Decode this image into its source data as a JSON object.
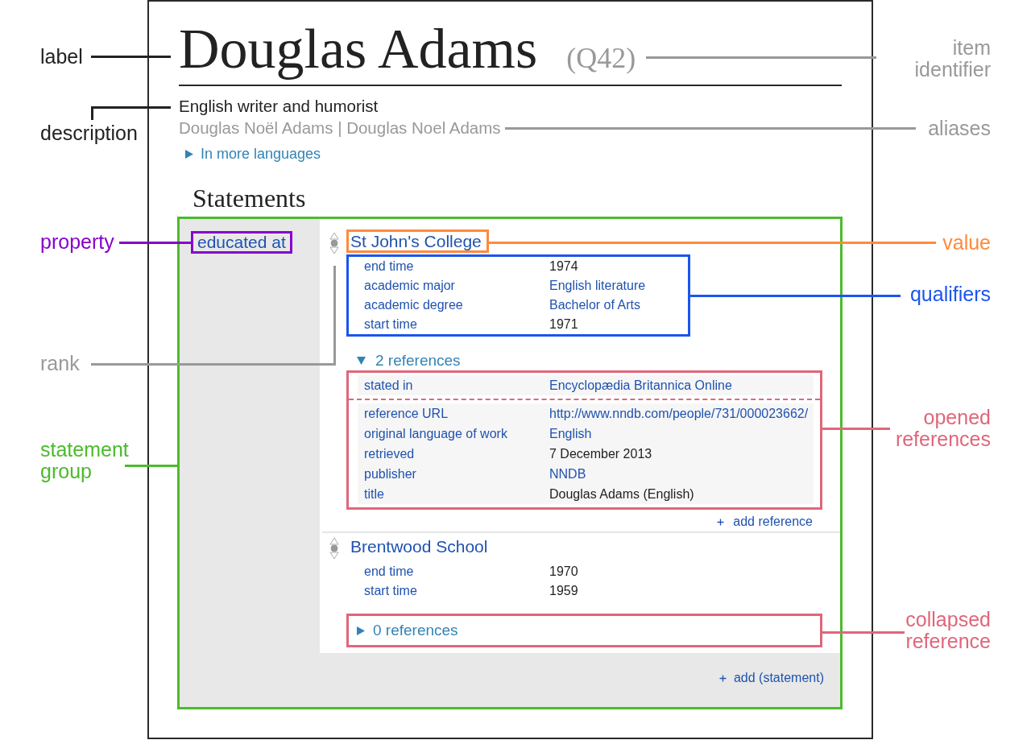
{
  "item": {
    "label": "Douglas Adams",
    "identifier": "(Q42)",
    "description": "English writer and humorist",
    "aliases": "Douglas Noël Adams | Douglas Noel Adams",
    "more_languages": {
      "label": "In more languages",
      "expanded": false
    }
  },
  "statements_heading": "Statements",
  "statement_group": {
    "property": "educated at",
    "statements": [
      {
        "preferred": false,
        "deprecated": false,
        "value": "St John's College",
        "qualifiers": [
          {
            "property": "end time",
            "value": "1974",
            "kind": "text"
          },
          {
            "property": "academic major",
            "value": "English literature",
            "kind": "link"
          },
          {
            "property": "academic degree",
            "value": "Bachelor of Arts",
            "kind": "link"
          },
          {
            "property": "start time",
            "value": "1971",
            "kind": "text"
          }
        ],
        "references": {
          "toggle": "2 references",
          "expanded": true,
          "list": [
            {
              "snaks": [
                {
                  "property": "stated in",
                  "value": "Encyclopædia Britannica Online",
                  "kind": "link"
                }
              ]
            },
            {
              "snaks": [
                {
                  "property": "reference URL",
                  "value": "http://www.nndb.com/people/731/000023662/",
                  "kind": "link"
                },
                {
                  "property": "original language of work",
                  "value": "English",
                  "kind": "link"
                },
                {
                  "property": "retrieved",
                  "value": "7 December 2013",
                  "kind": "text"
                },
                {
                  "property": "publisher",
                  "value": "NNDB",
                  "kind": "link"
                },
                {
                  "property": "title",
                  "value": "Douglas Adams (English)",
                  "kind": "text"
                }
              ]
            }
          ]
        },
        "add_reference": "add reference"
      },
      {
        "preferred": false,
        "deprecated": false,
        "value": "Brentwood School",
        "qualifiers": [
          {
            "property": "end time",
            "value": "1970",
            "kind": "text"
          },
          {
            "property": "start time",
            "value": "1959",
            "kind": "text"
          }
        ],
        "references": {
          "toggle": "0 references",
          "expanded": false
        }
      }
    ],
    "add_statement": "add (statement)"
  },
  "annotations": [
    {
      "text": "label",
      "color": "#222222"
    },
    {
      "text": "item identifier",
      "color": "#999999"
    },
    {
      "text": "description",
      "color": "#222222"
    },
    {
      "text": "aliases",
      "color": "#999999"
    },
    {
      "text": "property",
      "color": "#8800cc"
    },
    {
      "text": "value",
      "color": "#ff8a3d"
    },
    {
      "text": "qualifiers",
      "color": "#1a55ee"
    },
    {
      "text": "rank",
      "color": "#999999"
    },
    {
      "text": "opened references",
      "color": "#e0667a"
    },
    {
      "text": "statement group",
      "color": "#4cbb2c"
    },
    {
      "text": "collapsed reference",
      "color": "#e0667a"
    }
  ]
}
